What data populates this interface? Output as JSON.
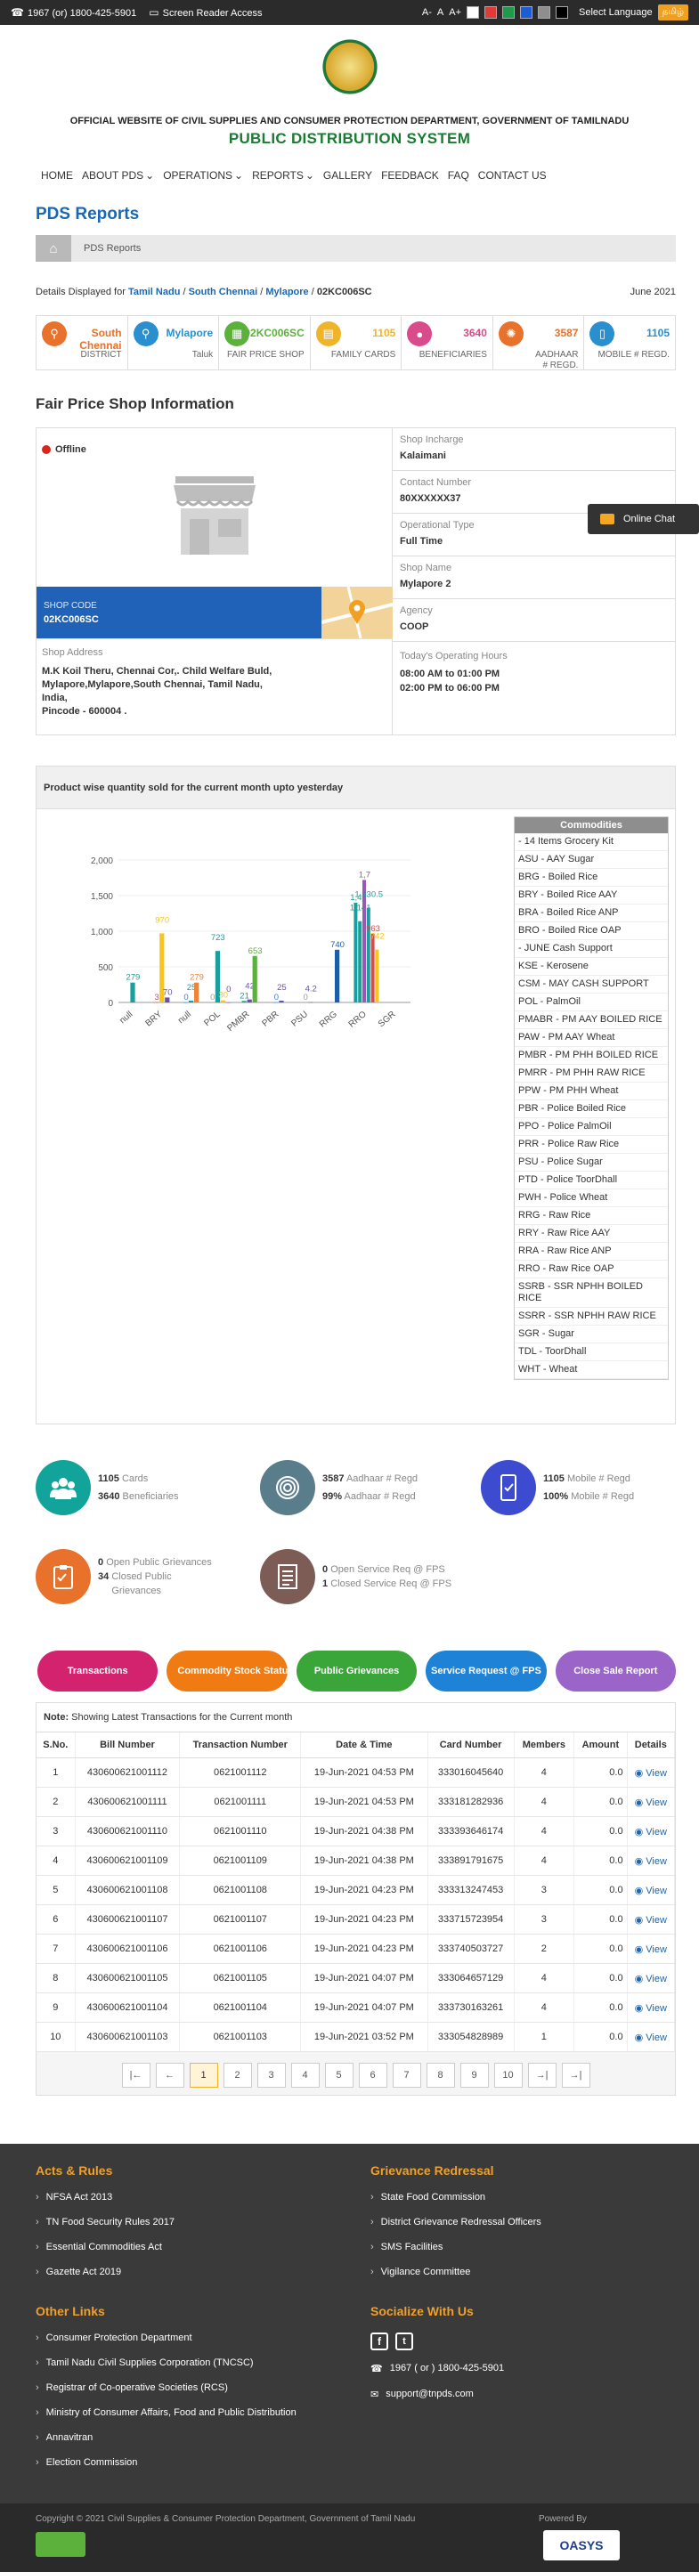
{
  "topbar": {
    "helpline": "1967 (or) 1800-425-5901",
    "screen_reader": "Screen Reader Access",
    "font_minus": "A-",
    "font_normal": "A",
    "font_plus": "A+",
    "select_language": "Select Language",
    "lang_btn": "தமிழ்",
    "swatches": [
      "#ffffff",
      "#e23a3a",
      "#1e9b4a",
      "#1e5bd6",
      "#8e8e8e",
      "#000000"
    ]
  },
  "header": {
    "dept": "OFFICIAL WEBSITE OF CIVIL SUPPLIES AND CONSUMER PROTECTION DEPARTMENT, GOVERNMENT OF TAMILNADU",
    "site": "PUBLIC DISTRIBUTION SYSTEM"
  },
  "nav": [
    "HOME",
    "ABOUT PDS",
    "OPERATIONS",
    "REPORTS",
    "GALLERY",
    "FEEDBACK",
    "FAQ",
    "CONTACT US"
  ],
  "page": {
    "title": "PDS Reports",
    "breadcrumb": "PDS Reports",
    "details_prefix": "Details Displayed for",
    "path": [
      "Tamil Nadu",
      "South Chennai",
      "Mylapore",
      "02KC006SC"
    ],
    "sep": " / ",
    "period": "June  2021"
  },
  "cards": [
    {
      "value": "South Chennai",
      "label": "DISTRICT",
      "color": "#e8712b",
      "icon": "map-pin"
    },
    {
      "value": "Mylapore",
      "label": "Taluk",
      "color": "#2a8fcf",
      "icon": "map-marker"
    },
    {
      "value": "02KC006SC",
      "label": "FAIR PRICE SHOP",
      "color": "#5cb03c",
      "icon": "shop"
    },
    {
      "value": "1105",
      "label": "FAMILY CARDS",
      "color": "#f0b429",
      "icon": "cards"
    },
    {
      "value": "3640",
      "label": "BENEFICIARIES",
      "color": "#d94b8a",
      "icon": "user"
    },
    {
      "value": "3587",
      "label": "AADHAAR # REGD.",
      "color": "#e8712b",
      "icon": "aadhaar"
    },
    {
      "value": "1105",
      "label": "MOBILE # REGD.",
      "color": "#2a8fcf",
      "icon": "mobile"
    }
  ],
  "fps": {
    "title": "Fair Price Shop Information",
    "status": "Offline",
    "shop_code_label": "SHOP CODE",
    "shop_code": "02KC006SC",
    "address_label": "Shop Address",
    "address_lines": [
      "M.K Koil Theru, Chennai Cor,. Child Welfare Buld,",
      "Mylapore,Mylapore,South Chennai, Tamil Nadu,",
      "India,",
      "Pincode - 600004 ."
    ],
    "incharge_label": "Shop Incharge",
    "incharge": "Kalaimani",
    "contact_label": "Contact Number",
    "contact": "80XXXXXX37",
    "optype_label": "Operational Type",
    "optype": "Full Time",
    "shopname_label": "Shop Name",
    "shopname": "Mylapore 2",
    "agency_label": "Agency",
    "agency": "COOP",
    "hours_label": "Today's Operating Hours",
    "hours": [
      "08:00 AM to 01:00 PM",
      "02:00 PM to 06:00 PM"
    ]
  },
  "online_chat": "Online Chat",
  "chart_panel": {
    "heading": "Product wise quantity sold for the current month upto yesterday",
    "commodities_title": "Commodities",
    "commodities": [
      "- 14 Items Grocery Kit",
      "ASU - AAY Sugar",
      "BRG - Boiled Rice",
      "BRY - Boiled Rice AAY",
      "BRA - Boiled Rice ANP",
      "BRO - Boiled Rice OAP",
      "- JUNE Cash Support",
      "KSE - Kerosene",
      "CSM - MAY CASH SUPPORT",
      "POL - PalmOil",
      "PMABR - PM AAY BOILED RICE",
      "PAW - PM AAY Wheat",
      "PMBR - PM PHH BOILED RICE",
      "PMRR - PM PHH RAW RICE",
      "PPW - PM PHH Wheat",
      "PBR - Police Boiled Rice",
      "PPO - Police PalmOil",
      "PRR - Police Raw Rice",
      "PSU - Police Sugar",
      "PTD - Police ToorDhall",
      "PWH - Police Wheat",
      "RRG - Raw Rice",
      "RRY - Raw Rice AAY",
      "RRA - Raw Rice ANP",
      "RRO - Raw Rice OAP",
      "SSRB - SSR NPHH BOILED RICE",
      "SSRR - SSR NPHH RAW RICE",
      "SGR - Sugar",
      "TDL - ToorDhall",
      "WHT - Wheat"
    ]
  },
  "chart_data": {
    "type": "bar",
    "ylim": [
      0,
      2000
    ],
    "yticks": [
      0,
      500,
      1000,
      1500,
      2000
    ],
    "ytick_labels": [
      "0",
      "500",
      "1,000",
      "1,500",
      "2,000"
    ],
    "xtick_labels": [
      "null",
      "BRY",
      "null",
      "POL",
      "PMBR",
      "PBR",
      "PSU",
      "RRG",
      "RRO",
      "SGR"
    ],
    "bars": [
      {
        "x": 0,
        "value": 279,
        "label": "279",
        "color": "#1b9e9e"
      },
      {
        "x": 1,
        "value": 3,
        "label": "3",
        "color": "#d64b4b"
      },
      {
        "x": 1,
        "value": 970,
        "label": "970",
        "color": "#f7c51e"
      },
      {
        "x": 1,
        "value": 70,
        "label": "70",
        "color": "#6a4fb0"
      },
      {
        "x": 2,
        "value": 0,
        "label": "0",
        "color": "#3b7fd0"
      },
      {
        "x": 2,
        "value": 25,
        "label": "25",
        "color": "#1b9e9e"
      },
      {
        "x": 2,
        "value": 279,
        "label": "279",
        "color": "#f0823a"
      },
      {
        "x": 3,
        "value": 0,
        "label": "0",
        "color": "#9a9a9a"
      },
      {
        "x": 3,
        "value": 723,
        "label": "723",
        "color": "#1b9e9e"
      },
      {
        "x": 3,
        "value": 30,
        "label": "30",
        "color": "#f7c51e"
      },
      {
        "x": 3,
        "value": 0,
        "label": "0",
        "color": "#6a4fb0"
      },
      {
        "x": 4,
        "value": 21,
        "label": "21",
        "color": "#1b9e9e"
      },
      {
        "x": 4,
        "value": 42,
        "label": "42",
        "color": "#6a4fb0"
      },
      {
        "x": 4,
        "value": 653,
        "label": "653",
        "color": "#5cb03c"
      },
      {
        "x": 5,
        "value": 0,
        "label": "0",
        "color": "#3b7fd0"
      },
      {
        "x": 5,
        "value": 25,
        "label": "25",
        "color": "#6a4fb0"
      },
      {
        "x": 6,
        "value": 0,
        "label": "0",
        "color": "#9a9a9a"
      },
      {
        "x": 6,
        "value": 4.2,
        "label": "4.2",
        "color": "#6a4fb0"
      },
      {
        "x": 7,
        "value": 740,
        "label": "740",
        "color": "#1b5fa8"
      },
      {
        "x": 8,
        "value": 1400,
        "label": "1,4",
        "color": "#1b9e9e"
      },
      {
        "x": 8,
        "value": 1141,
        "label": "1,141",
        "color": "#1b9e9e"
      },
      {
        "x": 8,
        "value": 1720,
        "label": "1,7",
        "color": "#9b59b6"
      },
      {
        "x": 8,
        "value": 1330.5,
        "label": "1,330.5",
        "color": "#1b9e9e"
      },
      {
        "x": 8,
        "value": 963,
        "label": "963",
        "color": "#d64b4b"
      },
      {
        "x": 8,
        "value": 742,
        "label": "742",
        "color": "#f7c51e"
      }
    ]
  },
  "stats": [
    {
      "l1v": "1105",
      "l1": "Cards",
      "l2v": "3640",
      "l2": "Beneficiaries",
      "color": "#12a39a",
      "icon": "people"
    },
    {
      "l1v": "3587",
      "l1": "Aadhaar # Regd",
      "l2v": "99%",
      "l2": "Aadhaar # Regd",
      "color": "#5a7d8c",
      "icon": "fingerprint"
    },
    {
      "l1v": "1105",
      "l1": "Mobile # Regd",
      "l2v": "100%",
      "l2": "Mobile # Regd",
      "color": "#3d4bd0",
      "icon": "mobile"
    },
    {
      "l1v": "0",
      "l1": "Open Public Grievances",
      "l2v": "34",
      "l2": "Closed Public Grievances",
      "color": "#e8712b",
      "icon": "clipboard"
    },
    {
      "l1v": "0",
      "l1": "Open Service Req @ FPS",
      "l2v": "1",
      "l2": "Closed Service Req @ FPS",
      "color": "#7d5c55",
      "icon": "document"
    }
  ],
  "tabs": [
    {
      "label": "Transactions",
      "color": "#d3226e"
    },
    {
      "label": "Commodity Stock Status",
      "color": "#f07b12"
    },
    {
      "label": "Public Grievances",
      "color": "#3aa63a"
    },
    {
      "label": "Service Request @ FPS",
      "color": "#1e82d6"
    },
    {
      "label": "Close Sale Report",
      "color": "#9a64c8"
    }
  ],
  "txn": {
    "note_bold": "Note:",
    "note": " Showing Latest Transactions for the Current month",
    "headers": [
      "S.No.",
      "Bill Number",
      "Transaction Number",
      "Date & Time",
      "Card Number",
      "Members",
      "Amount",
      "Details"
    ],
    "view_label": "View",
    "rows": [
      [
        "1",
        "430600621001112",
        "0621001112",
        "19-Jun-2021 04:53 PM",
        "333016045640",
        "4",
        "0.0"
      ],
      [
        "2",
        "430600621001111",
        "0621001111",
        "19-Jun-2021 04:53 PM",
        "333181282936",
        "4",
        "0.0"
      ],
      [
        "3",
        "430600621001110",
        "0621001110",
        "19-Jun-2021 04:38 PM",
        "333393646174",
        "4",
        "0.0"
      ],
      [
        "4",
        "430600621001109",
        "0621001109",
        "19-Jun-2021 04:38 PM",
        "333891791675",
        "4",
        "0.0"
      ],
      [
        "5",
        "430600621001108",
        "0621001108",
        "19-Jun-2021 04:23 PM",
        "333313247453",
        "3",
        "0.0"
      ],
      [
        "6",
        "430600621001107",
        "0621001107",
        "19-Jun-2021 04:23 PM",
        "333715723954",
        "3",
        "0.0"
      ],
      [
        "7",
        "430600621001106",
        "0621001106",
        "19-Jun-2021 04:23 PM",
        "333740503727",
        "2",
        "0.0"
      ],
      [
        "8",
        "430600621001105",
        "0621001105",
        "19-Jun-2021 04:07 PM",
        "333064657129",
        "4",
        "0.0"
      ],
      [
        "9",
        "430600621001104",
        "0621001104",
        "19-Jun-2021 04:07 PM",
        "333730163261",
        "4",
        "0.0"
      ],
      [
        "10",
        "430600621001103",
        "0621001103",
        "19-Jun-2021 03:52 PM",
        "333054828989",
        "1",
        "0.0"
      ]
    ],
    "pager": [
      "|←",
      "←",
      "1",
      "2",
      "3",
      "4",
      "5",
      "6",
      "7",
      "8",
      "9",
      "10",
      "→|",
      "→|"
    ]
  },
  "footer": {
    "acts_title": "Acts & Rules",
    "acts": [
      "NFSA Act 2013",
      "TN Food Security Rules 2017",
      "Essential Commodities Act",
      "Gazette Act 2019"
    ],
    "griev_title": "Grievance Redressal",
    "griev": [
      "State Food Commission",
      "District Grievance Redressal Officers",
      "SMS Facilities",
      "Vigilance Committee"
    ],
    "links_title": "Other Links",
    "links": [
      "Consumer Protection Department",
      "Tamil Nadu Civil Supplies Corporation (TNCSC)",
      "Registrar of Co-operative Societies (RCS)",
      "Ministry of Consumer Affairs, Food and Public Distribution",
      "Annavitran",
      "Election Commission"
    ],
    "social_title": "Socialize With Us",
    "phone": "1967 ( or ) 1800-425-5901",
    "email": "support@tnpds.com",
    "copyright": "Copyright © 2021 Civil Supplies & Consumer Protection Department, Government of Tamil Nadu",
    "powered_by": "Powered By",
    "powered_name": "OASYS"
  }
}
